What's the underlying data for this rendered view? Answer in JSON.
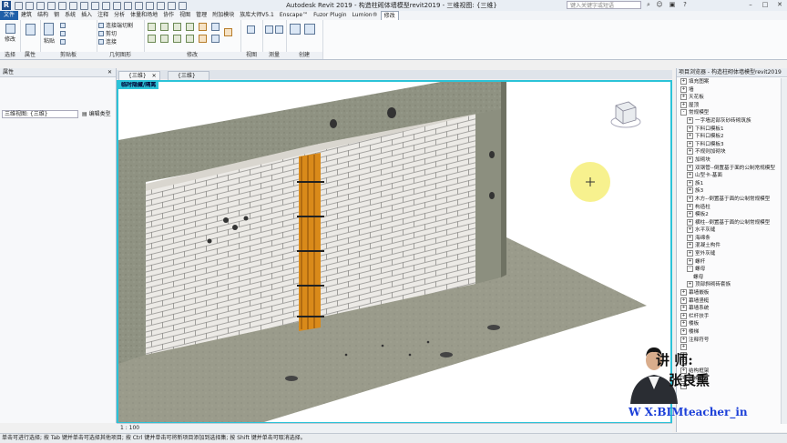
{
  "window": {
    "title": "Autodesk Revit 2019 - 构造柱砌体墙模型revit2019 - 三维视图: {三维}",
    "search_placeholder": "键入关键字或短语"
  },
  "ribbon_tabs": [
    "文件",
    "建筑",
    "结构",
    "钢",
    "系统",
    "插入",
    "注释",
    "分析",
    "体量和场地",
    "协作",
    "视图",
    "管理",
    "附加模块",
    "族库大师V5.1",
    "Enscape™",
    "Fuzor Plugin",
    "Lumion®",
    "修改"
  ],
  "active_tab": "修改",
  "ribbon_panels": {
    "select": "选择",
    "properties": "属性",
    "clipboard": "剪贴板",
    "geometry": "几何图形",
    "modify": "修改",
    "view": "视图",
    "measure": "测量",
    "create": "创建"
  },
  "ribbon_buttons": {
    "modify": "修改",
    "paste": "粘贴",
    "connect_end_cut": "连接端切割",
    "cut": "剪切",
    "join": "连接"
  },
  "properties": {
    "header": "属性",
    "type_selector": "三维视图: {三维}",
    "edit_type": "编辑类型"
  },
  "view_tabs": [
    "{三维}",
    "{三维}"
  ],
  "temp_view_label": "临时隐藏/隔离",
  "view_scale": "1 : 100",
  "status_text": "单击可进行选择; 按 Tab 键并单击可选择其他项目; 按 Ctrl 键并单击可将新项目添加到选择集; 按 Shift 键并单击可取消选择。",
  "browser": {
    "header": "项目浏览器 - 构造柱砌体墙模型revit2019",
    "items": [
      {
        "toggle": "+",
        "label": "填充图案",
        "level": 0
      },
      {
        "toggle": "+",
        "label": "墙",
        "level": 0
      },
      {
        "toggle": "+",
        "label": "天花板",
        "level": 0
      },
      {
        "toggle": "+",
        "label": "屋顶",
        "level": 0
      },
      {
        "toggle": "-",
        "label": "常规模型",
        "level": 0
      },
      {
        "toggle": "+",
        "label": "一字墙泥部灰砂砖砌筑族",
        "level": 1
      },
      {
        "toggle": "+",
        "label": "下料口模板1",
        "level": 1
      },
      {
        "toggle": "+",
        "label": "下料口模板2",
        "level": 1
      },
      {
        "toggle": "+",
        "label": "下料口模板3",
        "level": 1
      },
      {
        "toggle": "+",
        "label": "不规则加砌块",
        "level": 1
      },
      {
        "toggle": "+",
        "label": "加砌块",
        "level": 1
      },
      {
        "toggle": "+",
        "label": "双钢管--倒置基于面的公制常规模型",
        "level": 1
      },
      {
        "toggle": "+",
        "label": "山型卡-基面",
        "level": 1
      },
      {
        "toggle": "+",
        "label": "族1",
        "level": 1
      },
      {
        "toggle": "+",
        "label": "族3",
        "level": 1
      },
      {
        "toggle": "+",
        "label": "木方--倒置基于面的公制常规模型",
        "level": 1
      },
      {
        "toggle": "+",
        "label": "构造柱",
        "level": 1
      },
      {
        "toggle": "+",
        "label": "模板2",
        "level": 1
      },
      {
        "toggle": "+",
        "label": "横柱--倒置基于面的公制常规模型",
        "level": 1
      },
      {
        "toggle": "+",
        "label": "水平灰缝",
        "level": 1
      },
      {
        "toggle": "+",
        "label": "海绵条",
        "level": 1
      },
      {
        "toggle": "+",
        "label": "混凝土构件",
        "level": 1
      },
      {
        "toggle": "+",
        "label": "室外灰缝",
        "level": 1
      },
      {
        "toggle": "+",
        "label": "螺杆",
        "level": 1
      },
      {
        "toggle": "-",
        "label": "螺母",
        "level": 1
      },
      {
        "toggle": "",
        "label": "螺母",
        "level": 2
      },
      {
        "toggle": "+",
        "label": "顶部斜砌砖套族",
        "level": 1
      },
      {
        "toggle": "+",
        "label": "幕墙嵌板",
        "level": 0
      },
      {
        "toggle": "+",
        "label": "幕墙竖梃",
        "level": 0
      },
      {
        "toggle": "+",
        "label": "幕墙系统",
        "level": 0
      },
      {
        "toggle": "+",
        "label": "栏杆扶手",
        "level": 0
      },
      {
        "toggle": "+",
        "label": "楼板",
        "level": 0
      },
      {
        "toggle": "+",
        "label": "楼梯",
        "level": 0
      },
      {
        "toggle": "+",
        "label": "注释符号",
        "level": 0
      },
      {
        "toggle": "+",
        "label": "",
        "level": 0
      },
      {
        "toggle": "+",
        "label": "",
        "level": 0
      },
      {
        "toggle": "+",
        "label": "",
        "level": 0
      },
      {
        "toggle": "+",
        "label": "结构框架",
        "level": 0
      },
      {
        "toggle": "+",
        "label": "结构柱",
        "level": 0
      },
      {
        "toggle": "+",
        "label": "",
        "level": 0
      }
    ]
  },
  "overlay": {
    "instructor_label": "讲  师:",
    "instructor_name": "张良熏",
    "contact": "W X:BIMteacher_in"
  }
}
